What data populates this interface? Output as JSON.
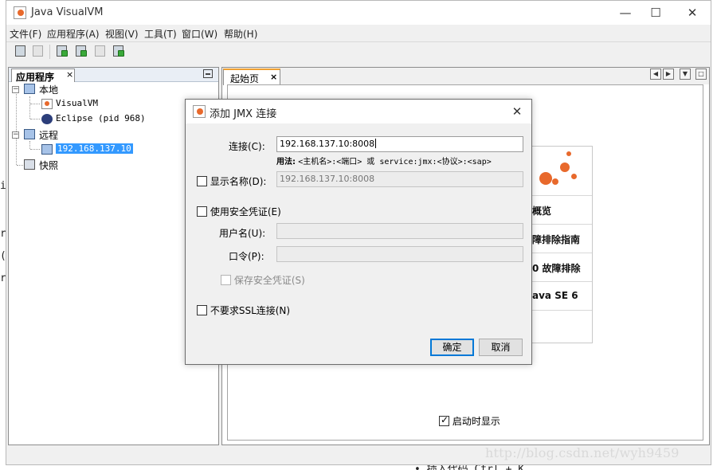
{
  "window": {
    "title": "Java VisualVM",
    "controls": {
      "minimize": "—",
      "maximize": "☐",
      "close": "✕"
    }
  },
  "menubar": {
    "items": [
      "文件(F)",
      "应用程序(A)",
      "视图(V)",
      "工具(T)",
      "窗口(W)",
      "帮助(H)"
    ]
  },
  "toolbar": {
    "buttons": [
      "load-icon",
      "save-icon",
      "add-jmx-icon",
      "add-remote-icon",
      "core-dump-icon",
      "snapshot-icon"
    ]
  },
  "left_panel": {
    "tab_label": "应用程序",
    "tab_close": "×",
    "tree": {
      "local": "本地",
      "visualvm": "VisualVM",
      "eclipse": "Eclipse (pid 968)",
      "remote": "远程",
      "remote_host": "192.168.137.10",
      "snapshots": "快照"
    }
  },
  "right_panel": {
    "tab_label": "起始页",
    "tab_close": "×",
    "card_items": [
      "概览",
      "障排除指南",
      "0 故障排除",
      "ava SE 6"
    ],
    "startup_checkbox": {
      "label": "启动时显示",
      "checked": true
    }
  },
  "background_fragments": {
    "left_glyphs": [
      "i",
      "r",
      "(",
      "r"
    ],
    "bottom_text": "• 插入代码 Ctrl + K"
  },
  "watermark": "http://blog.csdn.net/wyh9459",
  "dialog": {
    "title": "添加 JMX 连接",
    "close": "✕",
    "connection": {
      "label": "连接(C):",
      "value": "192.168.137.10:8008"
    },
    "usage": {
      "bold": "用法:",
      "text": "<主机名>:<端口> 或 service:jmx:<协议>:<sap>"
    },
    "display_name": {
      "label": "显示名称(D):",
      "checked": false,
      "value": "192.168.137.10:8008"
    },
    "use_security": {
      "label": "使用安全凭证(E)",
      "checked": false
    },
    "username": {
      "label": "用户名(U):",
      "value": ""
    },
    "password": {
      "label": "口令(P):",
      "value": ""
    },
    "save_security": {
      "label": "保存安全凭证(S)",
      "checked": false
    },
    "no_ssl": {
      "label": "不要求SSL连接(N)",
      "checked": false
    },
    "ok_label": "确定",
    "cancel_label": "取消",
    "accent_color": "#0078d7"
  }
}
